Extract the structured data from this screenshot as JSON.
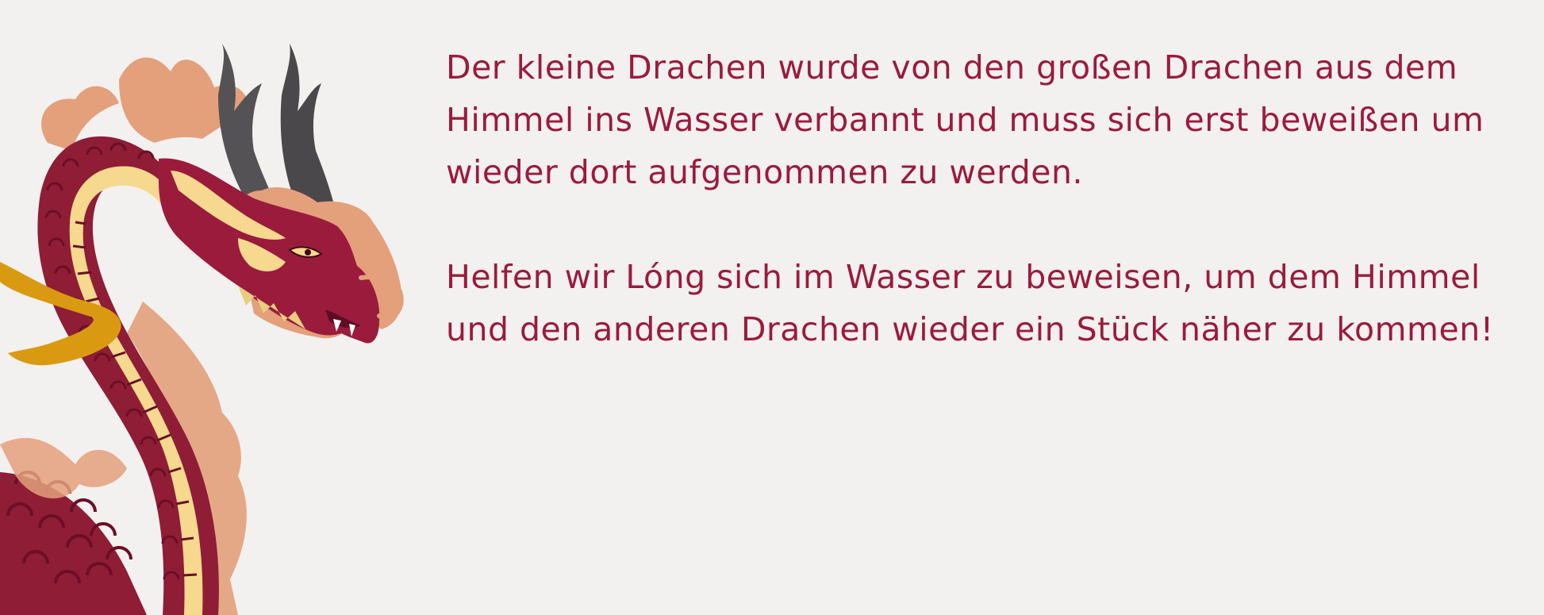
{
  "story": {
    "paragraph_1": "Der kleine Drachen wurde von den großen Drachen aus dem Himmel ins Wasser verbannt und muss sich erst beweißen um wieder dort aufgenommen zu werden.",
    "paragraph_2": "Helfen wir Lóng sich im Wasser zu beweisen, um dem Himmel und den anderen Drachen wieder ein Stück näher zu kommen!"
  },
  "colors": {
    "background": "#f3f1f0",
    "text": "#9b1b3d",
    "dragon_body": "#8f1d36",
    "dragon_belly": "#f6d98f",
    "dragon_mane": "#e3a07b",
    "dragon_horns": "#555255",
    "ribbon": "#d99a12"
  }
}
